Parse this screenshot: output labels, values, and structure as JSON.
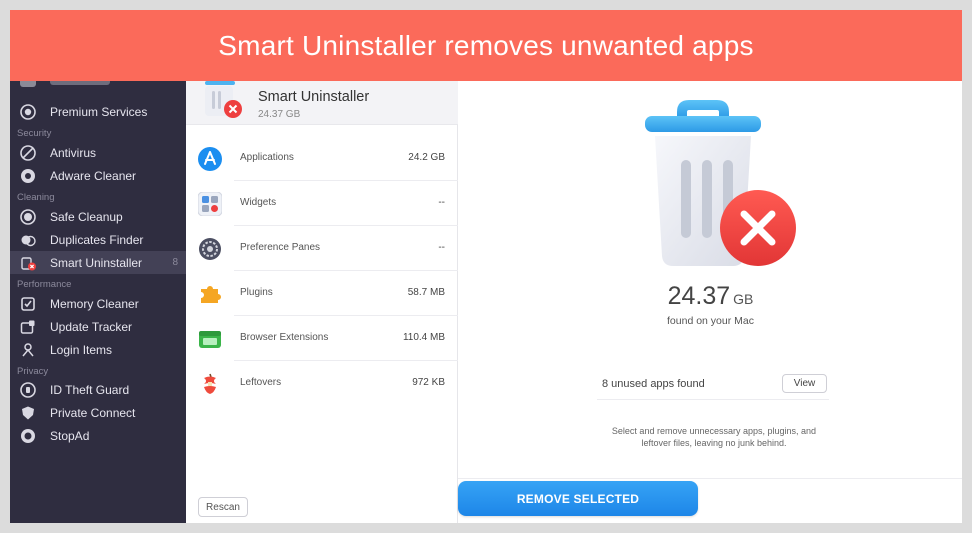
{
  "banner": {
    "text": "Smart Uninstaller removes unwanted apps"
  },
  "sidebar": {
    "sections": [
      {
        "label": "Security"
      },
      {
        "label": "Cleaning"
      },
      {
        "label": "Performance"
      },
      {
        "label": "Privacy"
      }
    ],
    "items": [
      {
        "label": "Premium Services",
        "icon": "premium-icon"
      },
      {
        "label": "Antivirus",
        "icon": "antivirus-icon"
      },
      {
        "label": "Adware Cleaner",
        "icon": "adware-icon"
      },
      {
        "label": "Safe Cleanup",
        "icon": "safe-cleanup-icon"
      },
      {
        "label": "Duplicates Finder",
        "icon": "duplicates-icon"
      },
      {
        "label": "Smart Uninstaller",
        "icon": "uninstaller-icon",
        "count": "8",
        "active": true
      },
      {
        "label": "Memory Cleaner",
        "icon": "memory-icon"
      },
      {
        "label": "Update Tracker",
        "icon": "update-icon"
      },
      {
        "label": "Login Items",
        "icon": "login-icon"
      },
      {
        "label": "ID Theft Guard",
        "icon": "id-theft-icon"
      },
      {
        "label": "Private Connect",
        "icon": "private-connect-icon"
      },
      {
        "label": "StopAd",
        "icon": "stopad-icon"
      }
    ]
  },
  "list_header": {
    "title": "Smart Uninstaller",
    "size": "24.37 GB"
  },
  "categories": [
    {
      "name": "Applications",
      "value": "24.2 GB",
      "icon": "app-store-icon"
    },
    {
      "name": "Widgets",
      "value": "--",
      "icon": "widgets-icon"
    },
    {
      "name": "Preference Panes",
      "value": "--",
      "icon": "gear-icon"
    },
    {
      "name": "Plugins",
      "value": "58.7 MB",
      "icon": "puzzle-icon"
    },
    {
      "name": "Browser Extensions",
      "value": "110.4 MB",
      "icon": "extension-icon"
    },
    {
      "name": "Leftovers",
      "value": "972 KB",
      "icon": "apple-core-icon"
    }
  ],
  "rescan_label": "Rescan",
  "summary": {
    "size_number": "24.37",
    "size_unit": "GB",
    "found_text": "found on your Mac",
    "unused_text": "8 unused apps found",
    "view_label": "View",
    "description": "Select and remove unnecessary apps, plugins, and leftover files, leaving no junk behind."
  },
  "remove_button": "REMOVE SELECTED",
  "colors": {
    "banner": "#fb6a5a",
    "sidebar": "#2f2d40",
    "accent_blue": "#1d86e8",
    "danger_red": "#ee3f3f"
  }
}
